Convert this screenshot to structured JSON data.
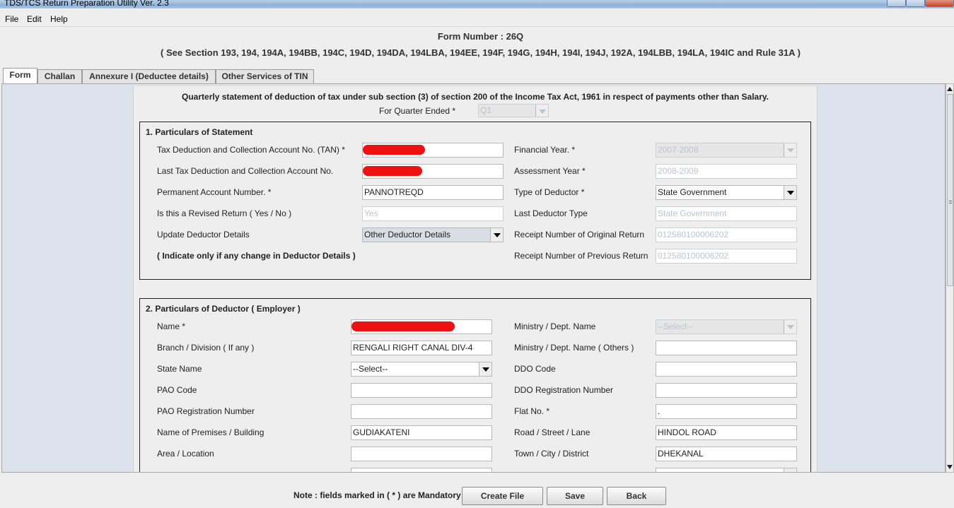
{
  "window": {
    "title": "TDS/TCS Return Preparation Utility Ver. 2.3"
  },
  "menu": {
    "file": "File",
    "edit": "Edit",
    "help": "Help"
  },
  "header": {
    "form_number": "Form Number : 26Q",
    "sections": "( See Section 193, 194, 194A, 194BB, 194C, 194D, 194DA, 194LBA, 194EE, 194F, 194G, 194H, 194I, 194J, 192A, 194LBB, 194LA, 194IC and Rule 31A )"
  },
  "tabs": [
    "Form",
    "Challan",
    "Annexure I (Deductee details)",
    "Other Services of TIN"
  ],
  "statement_title": "Quarterly statement of deduction of tax under sub section (3) of section 200 of the Income Tax Act, 1961 in respect of payments other than Salary.",
  "quarter": {
    "label": "For Quarter Ended *",
    "value": "Q1"
  },
  "section1": {
    "title": "1. Particulars of Statement",
    "tan_label": "Tax Deduction and Collection Account No. (TAN) *",
    "last_tan_label": "Last Tax Deduction and Collection Account No.",
    "pan_label": "Permanent Account Number. *",
    "pan_value": "PANNOTREQD",
    "revised_label": "Is this a Revised Return ( Yes / No )",
    "revised_value": "Yes",
    "update_label": "Update Deductor Details",
    "update_value": "Other Deductor Details",
    "indicate_note": "( Indicate only if any change in Deductor Details )",
    "fy_label": "Financial Year. *",
    "fy_value": "2007-2008",
    "ay_label": "Assessment Year *",
    "ay_value": "2008-2009",
    "deductor_type_label": "Type of Deductor *",
    "deductor_type_value": "State Government",
    "last_deductor_type_label": "Last Deductor Type",
    "last_deductor_type_value": "State Government",
    "receipt_original_label": "Receipt Number of Original Return",
    "receipt_original_value": "012580100006202",
    "receipt_previous_label": "Receipt Number of Previous Return",
    "receipt_previous_value": "012580100006202"
  },
  "section2": {
    "title": "2. Particulars of Deductor ( Employer )",
    "name_label": "Name *",
    "branch_label": "Branch / Division ( If any )",
    "branch_value": "RENGALI RIGHT CANAL DIV-4",
    "state_label": "State Name",
    "state_value": "--Select--",
    "pao_code_label": "PAO Code",
    "pao_reg_label": "PAO Registration Number",
    "premises_label": "Name of Premises / Building",
    "premises_value": "GUDIAKATENI",
    "area_label": "Area / Location",
    "ministry_label": "Ministry / Dept. Name",
    "ministry_value": "--Select--",
    "ministry_others_label": "Ministry / Dept. Name ( Others )",
    "ddo_code_label": "DDO Code",
    "ddo_reg_label": "DDO Registration Number",
    "flat_label": "Flat No. *",
    "flat_value": ".",
    "road_label": "Road / Street / Lane",
    "road_value": "HINDOL ROAD",
    "town_label": "Town / City / District",
    "town_value": "DHEKANAL"
  },
  "footer": {
    "note": "Note : fields marked in ( * ) are Mandatory",
    "create_file": "Create File",
    "save": "Save",
    "back": "Back"
  }
}
